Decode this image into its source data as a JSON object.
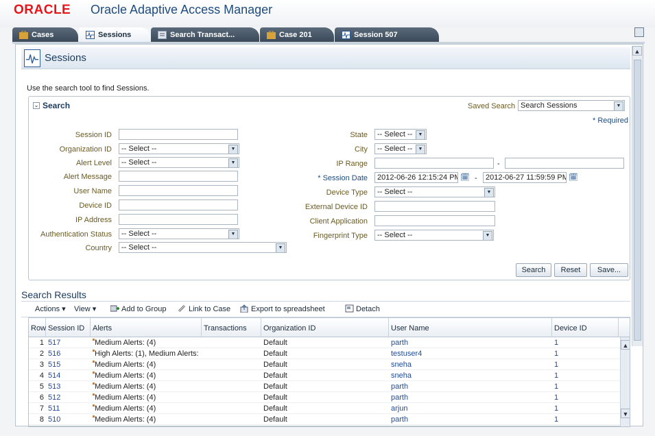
{
  "header": {
    "logo": "ORACLE",
    "title": "Oracle Adaptive Access Manager"
  },
  "tabs": [
    {
      "label": "Cases"
    },
    {
      "label": "Sessions"
    },
    {
      "label": "Search Transact..."
    },
    {
      "label": "Case 201"
    },
    {
      "label": "Session 507"
    }
  ],
  "page": {
    "title": "Sessions",
    "intro": "Use the search tool to find Sessions."
  },
  "search": {
    "title": "Search",
    "saved_label": "Saved Search",
    "saved_value": "Search Sessions",
    "required_note": "* Required",
    "labels": {
      "session_id": "Session ID",
      "organization_id": "Organization ID",
      "alert_level": "Alert Level",
      "alert_message": "Alert Message",
      "user_name": "User Name",
      "device_id": "Device ID",
      "ip_address": "IP Address",
      "authentication_status": "Authentication Status",
      "country": "Country",
      "state": "State",
      "city": "City",
      "ip_range": "IP Range",
      "session_date": "* Session Date",
      "device_type": "Device Type",
      "external_device_id": "External Device ID",
      "client_application": "Client Application",
      "fingerprint_type": "Fingerprint Type"
    },
    "values": {
      "select": "-- Select --",
      "ip_range_sep": "-",
      "date_sep": "-",
      "date_from": "2012-06-26 12:15:24 PM",
      "date_to": "2012-06-27 11:59:59 PM"
    },
    "buttons": {
      "search": "Search",
      "reset": "Reset",
      "save": "Save..."
    }
  },
  "results": {
    "title": "Search Results",
    "toolbar": {
      "actions": "Actions ▾",
      "view": "View ▾",
      "add_group": "Add to Group",
      "link_case": "Link to Case",
      "export": "Export to spreadsheet",
      "detach": "Detach"
    },
    "columns": [
      "Row",
      "Session ID",
      "Alerts",
      "Transactions",
      "Organization ID",
      "User Name",
      "Device ID"
    ],
    "rows": [
      {
        "row": "1",
        "session_id": "517",
        "alerts": "Medium Alerts: (4)",
        "transactions": "",
        "org": "Default",
        "user": "parth",
        "device": "1"
      },
      {
        "row": "2",
        "session_id": "516",
        "alerts": "High Alerts: (1), Medium Alerts:",
        "transactions": "",
        "org": "Default",
        "user": "testuser4",
        "device": "1"
      },
      {
        "row": "3",
        "session_id": "515",
        "alerts": "Medium Alerts: (4)",
        "transactions": "",
        "org": "Default",
        "user": "sneha",
        "device": "1"
      },
      {
        "row": "4",
        "session_id": "514",
        "alerts": "Medium Alerts: (4)",
        "transactions": "",
        "org": "Default",
        "user": "sneha",
        "device": "1"
      },
      {
        "row": "5",
        "session_id": "513",
        "alerts": "Medium Alerts: (4)",
        "transactions": "",
        "org": "Default",
        "user": "parth",
        "device": "1"
      },
      {
        "row": "6",
        "session_id": "512",
        "alerts": "Medium Alerts: (4)",
        "transactions": "",
        "org": "Default",
        "user": "parth",
        "device": "1"
      },
      {
        "row": "7",
        "session_id": "511",
        "alerts": "Medium Alerts: (4)",
        "transactions": "",
        "org": "Default",
        "user": "arjun",
        "device": "1"
      },
      {
        "row": "8",
        "session_id": "510",
        "alerts": "Medium Alerts: (4)",
        "transactions": "",
        "org": "Default",
        "user": "parth",
        "device": "1"
      }
    ]
  },
  "colors": {
    "brand_red": "#e8141a",
    "title_blue": "#1f4b7e",
    "label_olive": "#6a5a20",
    "alert_orange": "#e07a10"
  }
}
